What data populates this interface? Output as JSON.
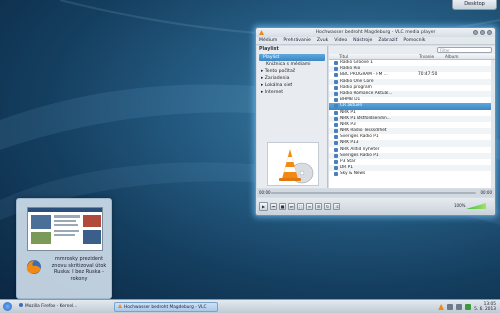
{
  "desktop": {
    "button_label": "Desktop"
  },
  "vlc": {
    "title": "Hochwasser bedroht Magdeburg - VLC media player",
    "menu": [
      "Médium",
      "Prehrávanie",
      "Zvuk",
      "Video",
      "Nástroje",
      "Zobraziť",
      "Pomocník"
    ],
    "sidebar": {
      "title": "Playlist",
      "items": [
        {
          "label": "Playlist",
          "selected": true
        },
        {
          "label": "Knižnica s médiami",
          "selected": false
        },
        {
          "label": "Tento počítač",
          "selected": false
        },
        {
          "label": "Zariadenia",
          "selected": false
        },
        {
          "label": "Lokálna sieť",
          "selected": false
        },
        {
          "label": "Internet",
          "selected": false
        }
      ]
    },
    "search_placeholder": "Filter",
    "columns": [
      "Titul",
      "Trvanie",
      "Album"
    ],
    "playlist": [
      {
        "title": "Radio Groove 1",
        "duration": ""
      },
      {
        "title": "Radio Rio",
        "duration": ""
      },
      {
        "title": "BBC PROGRAM - FM ...",
        "duration": "70:47:50"
      },
      {
        "title": "Radio One Core",
        "duration": ""
      },
      {
        "title": "Radio program",
        "duration": ""
      },
      {
        "title": "Radio Romance Aktuál...",
        "duration": ""
      },
      {
        "title": "BHMB D1",
        "duration": ""
      },
      {
        "title": "ČR aktuell",
        "duration": "",
        "selected": true
      },
      {
        "title": "NRK P1",
        "duration": ""
      },
      {
        "title": "NRK P1 Østfoldsendin...",
        "duration": ""
      },
      {
        "title": "NRK P3",
        "duration": ""
      },
      {
        "title": "NRK Radio Tesssdrhet",
        "duration": ""
      },
      {
        "title": "Sveriges Radio P1",
        "duration": ""
      },
      {
        "title": "NRK P13",
        "duration": ""
      },
      {
        "title": "NRK Alltid nyheter",
        "duration": ""
      },
      {
        "title": "Sveriges Radio P1",
        "duration": ""
      },
      {
        "title": "P3 Star",
        "duration": ""
      },
      {
        "title": "DR P1",
        "duration": ""
      },
      {
        "title": "Sky & News",
        "duration": ""
      }
    ],
    "time_elapsed": "00:00",
    "time_total": "00:00",
    "volume": "100%",
    "accent": "#3b86c4"
  },
  "preview": {
    "text": "mmrosky prezident znovu skritizoval útok Ruska: I bez Ruska - rokony"
  },
  "taskbar": {
    "tasks": [
      {
        "label": "Mozilla Firefox - Kernel...",
        "active": false
      },
      {
        "label": "Hochwasser bedroht Magdeburg - VLC",
        "active": true
      }
    ],
    "clock_time": "13:05",
    "clock_date": "5. 6. 2013"
  }
}
